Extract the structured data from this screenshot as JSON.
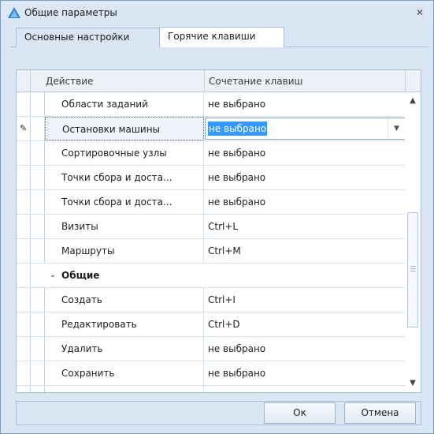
{
  "window": {
    "title": "Общие параметры",
    "close_label": "✕"
  },
  "tabs": [
    {
      "label": "Основные настройки"
    },
    {
      "label": "Горячие клавиши"
    }
  ],
  "grid": {
    "columns": {
      "action": "Действие",
      "keys": "Сочетание клавиш"
    },
    "rows": [
      {
        "action": "Области заданий",
        "keys": "не выбрано"
      },
      {
        "action": "Остановки машины",
        "keys": "не выбрано"
      },
      {
        "action": "Сортировочные узлы",
        "keys": "не выбрано"
      },
      {
        "action": "Точки сбора и доста...",
        "keys": "не выбрано"
      },
      {
        "action": "Точки сбора и доста...",
        "keys": "не выбрано"
      },
      {
        "action": "Визиты",
        "keys": "Ctrl+L"
      },
      {
        "action": "Маршруты",
        "keys": "Ctrl+M"
      },
      {
        "group": "Общие"
      },
      {
        "action": "Создать",
        "keys": "Ctrl+I"
      },
      {
        "action": "Редактировать",
        "keys": "Ctrl+D"
      },
      {
        "action": "Удалить",
        "keys": "не выбрано"
      },
      {
        "action": "Сохранить",
        "keys": "не выбрано"
      }
    ]
  },
  "buttons": {
    "ok": "Ок",
    "cancel": "Отмена"
  }
}
